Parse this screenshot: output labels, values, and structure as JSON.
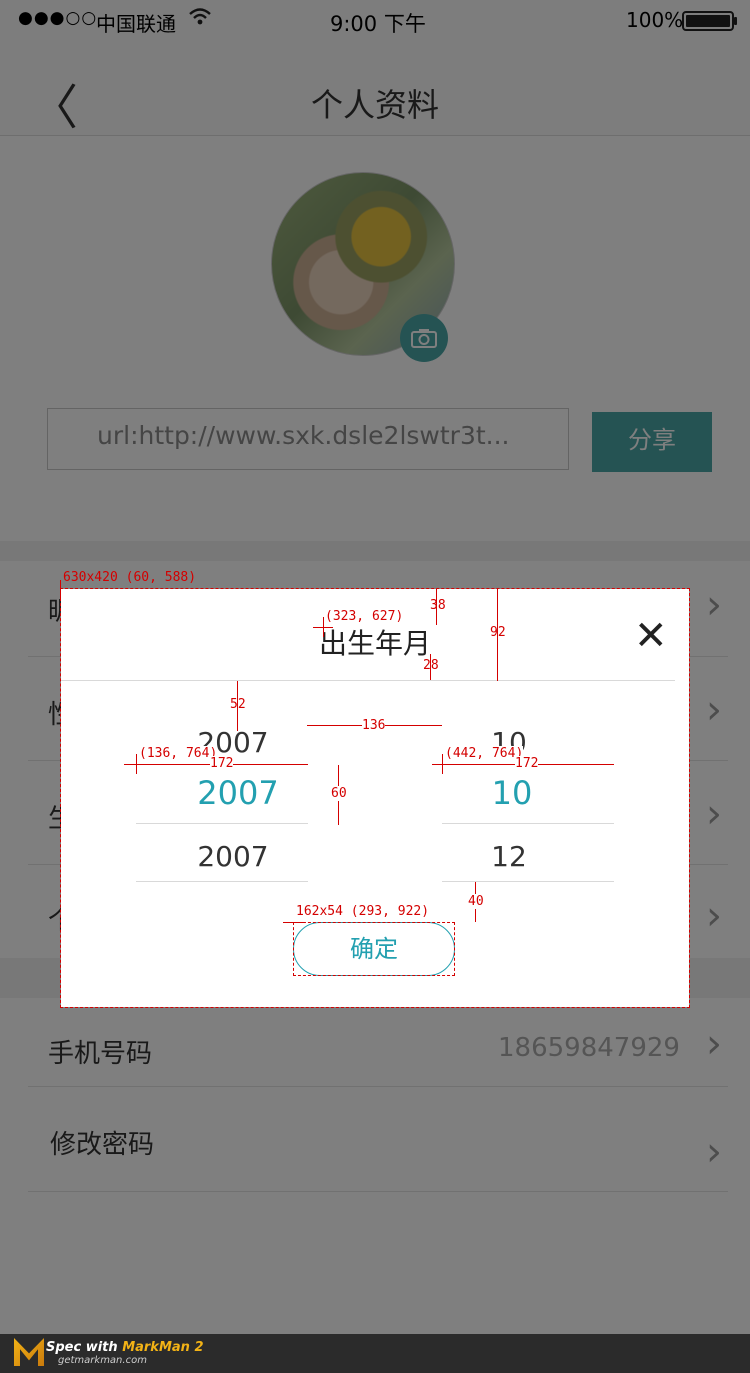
{
  "status_bar": {
    "signal": "●●●○○",
    "carrier": "中国联通",
    "time": "9:00 下午",
    "battery_pct": "100%"
  },
  "nav": {
    "title": "个人资料",
    "back": "〈"
  },
  "profile": {
    "camera": "⌂",
    "url": "url:http://www.sxk.dsle2lswtr3t...",
    "share_label": "分享"
  },
  "rows": [
    {
      "label": "昵"
    },
    {
      "label": "性"
    },
    {
      "label": "生"
    },
    {
      "label": "个"
    },
    {
      "label": "手机号码",
      "value": "18659847929"
    },
    {
      "label": "修改密码"
    }
  ],
  "modal": {
    "title": "出生年月",
    "close": "✕",
    "years": [
      "2007",
      "2007",
      "2007"
    ],
    "months": [
      "10",
      "10",
      "12"
    ],
    "confirm_label": "确定"
  },
  "annotations": {
    "modal_box": "630x420 (60, 588)",
    "title_pos": "(323, 627)",
    "title_top": "38",
    "title_bottom": "28",
    "header_h": "92",
    "picker_top": "52",
    "col_gap": "136",
    "year_pos": "(136, 764)",
    "year_w": "172",
    "month_pos": "(442, 764)",
    "month_w": "172",
    "row_h": "60",
    "btn_gap": "40",
    "btn_box": "162x54 (293, 922)"
  },
  "footer": {
    "title_prefix": "Spec with ",
    "title_brand": "MarkMan 2",
    "site": "getmarkman.com"
  }
}
